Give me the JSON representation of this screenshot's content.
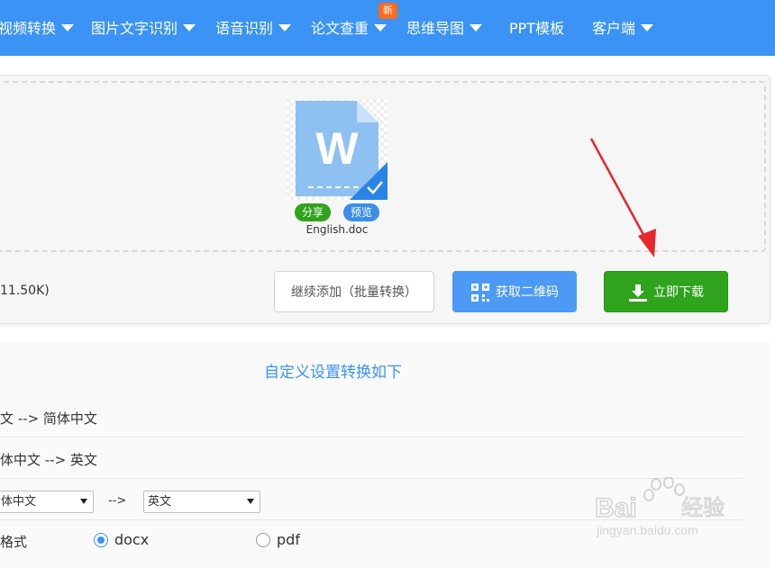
{
  "nav": {
    "items": [
      {
        "label": "视频转换",
        "caret": true
      },
      {
        "label": "图片文字识别",
        "caret": true
      },
      {
        "label": "语音识别",
        "caret": true
      },
      {
        "label": "论文查重",
        "caret": true
      },
      {
        "label": "思维导图",
        "caret": true
      },
      {
        "label": "PPT模板",
        "caret": false
      },
      {
        "label": "客户端",
        "caret": true
      }
    ],
    "new_badge": "新"
  },
  "file": {
    "icon_letter": "W",
    "share_label": "分享",
    "preview_label": "预览",
    "name": "English.doc",
    "size_text": "11.50K)"
  },
  "actions": {
    "continue_label": "继续添加（批量转换）",
    "qr_label": "获取二维码",
    "download_label": "立即下载"
  },
  "settings": {
    "title": "自定义设置转换如下",
    "options": [
      "文 --> 简体中文",
      "体中文 --> 英文"
    ],
    "from_select": "体中文",
    "arrow_text": "-->",
    "to_select": "英文",
    "format_label": "格式",
    "formats": [
      {
        "label": "docx",
        "selected": true
      },
      {
        "label": "pdf",
        "selected": false
      }
    ]
  },
  "watermark": {
    "brand": "Bai",
    "brand_cn": "经验",
    "url": "jingyan.baidu.com"
  },
  "colors": {
    "nav_bg": "#3a93f5",
    "download_green": "#2fa31c",
    "qr_blue": "#4c9af5",
    "new_badge": "#ff6a1f",
    "annotation_arrow": "#e8262b"
  }
}
